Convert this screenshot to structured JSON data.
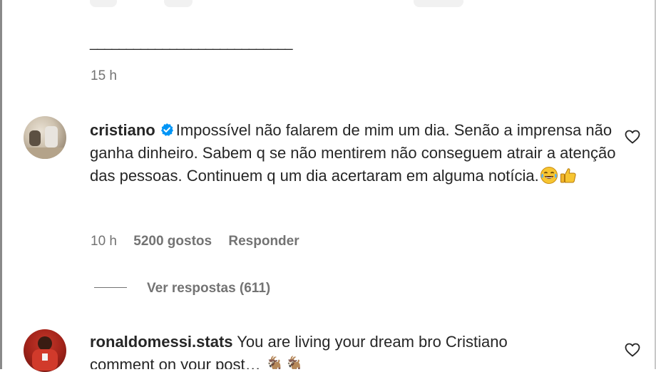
{
  "previous_comment": {
    "separator": "____________________________",
    "timestamp": "15 h"
  },
  "comments": [
    {
      "username": "cristiano",
      "verified": true,
      "text": "Impossível não falarem de mim um dia. Senão a imprensa não ganha dinheiro. Sabem q se não mentirem não conseguem atrair a atenção das pessoas. Continuem q um dia acertaram em alguma notícia.",
      "emojis": [
        "tears-of-joy-emoji",
        "thumbs-up-emoji"
      ],
      "timestamp": "10 h",
      "likes": "5200 gostos",
      "reply_label": "Responder",
      "view_replies_label": "Ver respostas (611)",
      "avatar_icon": "profile-photo"
    },
    {
      "username": "ronaldomessi.stats",
      "verified": false,
      "text": "You are living your dream bro Cristiano",
      "second_line_partial": "comment on your post… 🐐🐐",
      "avatar_icon": "profile-photo"
    }
  ],
  "icons": {
    "like": "heart-outline-icon",
    "verified": "verified-badge-icon"
  },
  "colors": {
    "text": "#262626",
    "secondary": "#737373",
    "verified_blue": "#0095f6"
  }
}
